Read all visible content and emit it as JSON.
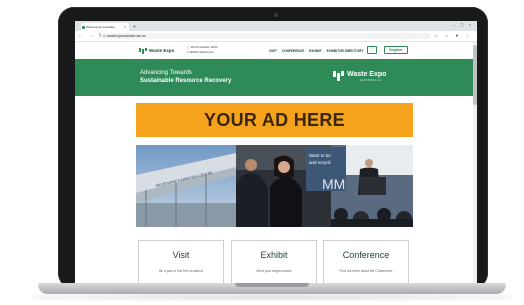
{
  "browser": {
    "tab_title": "Waste Expo Australia",
    "tab_close": "×",
    "new_tab": "+",
    "window_controls": "– ▢ ×",
    "url": "wasteexpoaustralia.com.au",
    "lock": "⊙",
    "nav_icons": "← → ↻",
    "right_icons": "☆ ⌂ ● ⋮"
  },
  "header": {
    "logo": "Waste Expo",
    "event_date": "22-23 October 2024",
    "event_venue": "MCEC Melbourne",
    "date_icon": "calendar-icon",
    "venue_icon": "pin-icon",
    "nav": [
      "VISIT",
      "CONFERENCE",
      "EXHIBIT",
      "EXHIBITOR DIRECTORY"
    ],
    "heart": "♡",
    "register_label": "Register"
  },
  "hero": {
    "line1": "Advancing Towards",
    "line2": "Sustainable Resource Recovery",
    "logo": "Waste Expo",
    "logo_sub": "AUSTRALIA"
  },
  "ad": {
    "text": "YOUR AD HERE",
    "color": "#f5a21c"
  },
  "photo": {
    "sign_text": "MELBOURNE EXHIBITION CENTRE",
    "screen_text_1": "Want to bri",
    "screen_text_2": "and recycli",
    "screen_text_3": "MM"
  },
  "cards": [
    {
      "title": "Visit",
      "sub": "Be a part of this free-to-attend"
    },
    {
      "title": "Exhibit",
      "sub": "Meet your target market"
    },
    {
      "title": "Conference",
      "sub": "Find out more about the Conference"
    }
  ],
  "colors": {
    "brand_green": "#2e8b57",
    "dark_green": "#1e3d2f"
  }
}
